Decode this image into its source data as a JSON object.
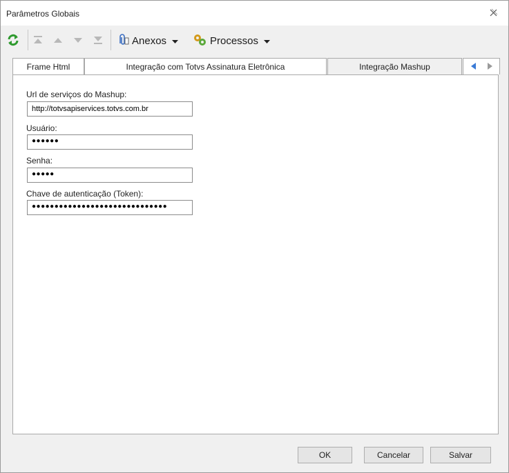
{
  "window": {
    "title": "Parâmetros Globais"
  },
  "toolbar": {
    "anexos_label": "Anexos",
    "processos_label": "Processos"
  },
  "tabs": [
    {
      "label": "Frame Html"
    },
    {
      "label": "Integração com Totvs Assinatura Eletrônica"
    },
    {
      "label": "Integração Mashup"
    }
  ],
  "form": {
    "url_label": "Url de serviços do Mashup:",
    "url_value": "http://totvsapiservices.totvs.com.br",
    "user_label": "Usuário:",
    "user_value": "●●●●●●",
    "password_label": "Senha:",
    "password_value": "●●●●●",
    "token_label": "Chave de autenticação (Token):",
    "token_value": "●●●●●●●●●●●●●●●●●●●●●●●●●●●●●●"
  },
  "footer": {
    "ok_label": "OK",
    "cancel_label": "Cancelar",
    "save_label": "Salvar"
  },
  "colors": {
    "accent": "#3b7bd6",
    "refresh_green": "#2e9a2e",
    "gear_gold": "#d39a1b"
  }
}
